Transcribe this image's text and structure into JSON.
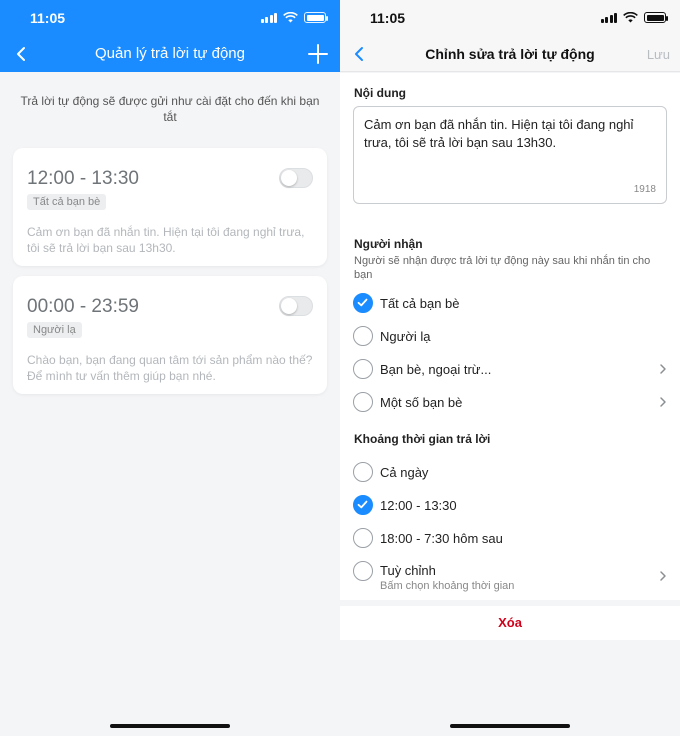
{
  "left_screen": {
    "status_time": "11:05",
    "title": "Quản lý trả lời tự động",
    "hint": "Trả lời tự động sẽ được gửi như cài đặt cho đến khi bạn tắt",
    "colors": {
      "header": "#1a8cff"
    },
    "cards": [
      {
        "time_range": "12:00 - 13:30",
        "recipient_tag": "Tất cả bạn bè",
        "message": "Cảm ơn bạn đã nhắn tin. Hiện tại tôi đang nghỉ trưa, tôi sẽ trả lời bạn sau 13h30.",
        "enabled": false
      },
      {
        "time_range": "00:00 - 23:59",
        "recipient_tag": "Người lạ",
        "message": "Chào bạn, bạn đang quan tâm tới sản phẩm nào thế? Để mình tư vấn thêm giúp bạn nhé.",
        "enabled": false
      }
    ]
  },
  "right_screen": {
    "status_time": "11:05",
    "title": "Chỉnh sửa trả lời tự động",
    "save_label": "Lưu",
    "content_section": {
      "label": "Nội dung",
      "text": "Cảm ơn bạn đã nhắn tin. Hiện tại tôi đang nghỉ trưa, tôi sẽ trả lời bạn sau 13h30.",
      "char_count": "1918"
    },
    "recipient_section": {
      "label": "Người nhận",
      "hint": "Người sẽ nhận được trả lời tự động này sau khi nhắn tin cho bạn",
      "options": [
        {
          "label": "Tất cả bạn bè",
          "selected": true,
          "has_chevron": false
        },
        {
          "label": "Người lạ",
          "selected": false,
          "has_chevron": false
        },
        {
          "label": "Bạn bè, ngoại trừ...",
          "selected": false,
          "has_chevron": true
        },
        {
          "label": "Một số bạn bè",
          "selected": false,
          "has_chevron": true
        }
      ]
    },
    "time_section": {
      "label": "Khoảng thời gian trả lời",
      "options": [
        {
          "label": "Cả ngày",
          "selected": false
        },
        {
          "label": "12:00 - 13:30",
          "selected": true
        },
        {
          "label": "18:00 - 7:30 hôm sau",
          "selected": false
        },
        {
          "label": "Tuỳ chỉnh",
          "sublabel": "Bấm chọn khoảng thời gian",
          "selected": false,
          "has_chevron": true
        }
      ]
    },
    "delete_label": "Xóa",
    "colors": {
      "accent": "#1a8cff",
      "danger": "#d0021b"
    }
  }
}
